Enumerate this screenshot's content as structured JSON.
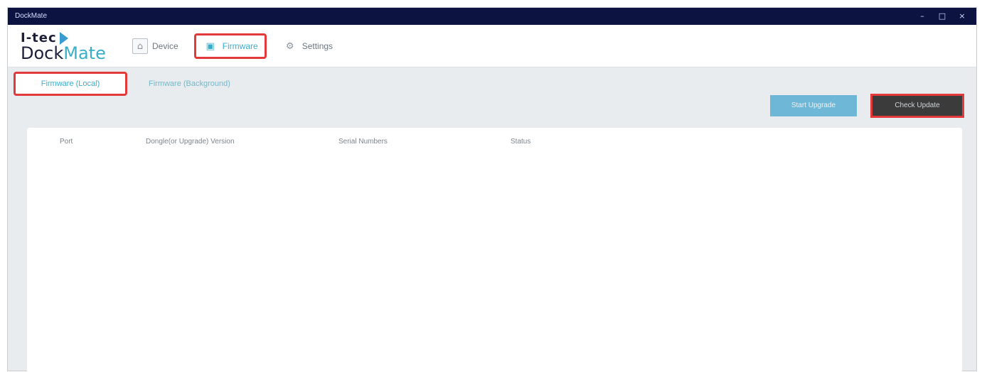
{
  "window": {
    "title": "DockMate",
    "controls": {
      "minimize": "–",
      "maximize": "□",
      "close": "×"
    }
  },
  "logo": {
    "top": "I-tec",
    "bottom_left": "Dock",
    "bottom_right": "Mate"
  },
  "nav": [
    {
      "label": "Device",
      "icon": "home-icon",
      "glyph": "⌂"
    },
    {
      "label": "Firmware",
      "icon": "firmware-chip-icon",
      "glyph": "▣",
      "active": true
    },
    {
      "label": "Settings",
      "icon": "gear-icon",
      "glyph": "⚙"
    }
  ],
  "subtabs": [
    {
      "label": "Firmware (Local)",
      "active": true
    },
    {
      "label": "Firmware (Background)",
      "active": false
    }
  ],
  "buttons": {
    "upgrade": "Start Upgrade",
    "check": "Check Update"
  },
  "table": {
    "columns": [
      "Port",
      "Dongle(or Upgrade) Version",
      "Serial Numbers",
      "Status"
    ],
    "rows": []
  },
  "colors": {
    "titlebar": "#0c1340",
    "accent": "#3aaec9",
    "highlight": "#e23a3a",
    "upgrade_button": "#6fb7d6",
    "check_button": "#3b3b3b"
  }
}
